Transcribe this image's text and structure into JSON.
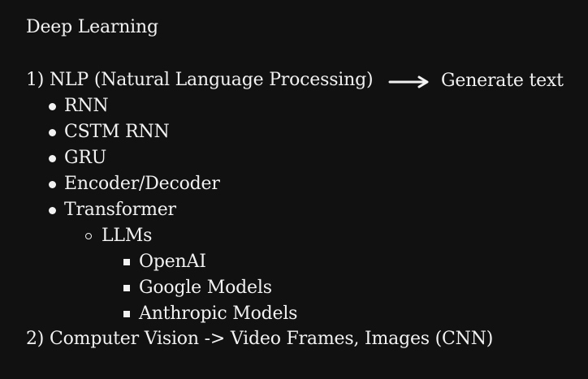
{
  "title": "Deep Learning",
  "section1": {
    "heading": "1) NLP (Natural Language Processing)",
    "arrow_target": "Generate text",
    "items": [
      {
        "label": "RNN"
      },
      {
        "label": "CSTM RNN"
      },
      {
        "label": "GRU"
      },
      {
        "label": "Encoder/Decoder"
      },
      {
        "label": "Transformer"
      }
    ],
    "sub": {
      "label": "LLMs",
      "items": [
        {
          "label": "OpenAI"
        },
        {
          "label": "Google Models"
        },
        {
          "label": "Anthropic Models"
        }
      ]
    }
  },
  "section2": {
    "heading": "2) Computer Vision -> Video Frames, Images (CNN)"
  },
  "colors": {
    "background": "#111111",
    "text": "#f2f2f2"
  },
  "icons": {
    "arrow": "right-arrow-icon",
    "level1_bullet": "filled-circle-bullet",
    "level2_bullet": "hollow-circle-bullet",
    "level3_bullet": "filled-square-bullet"
  }
}
